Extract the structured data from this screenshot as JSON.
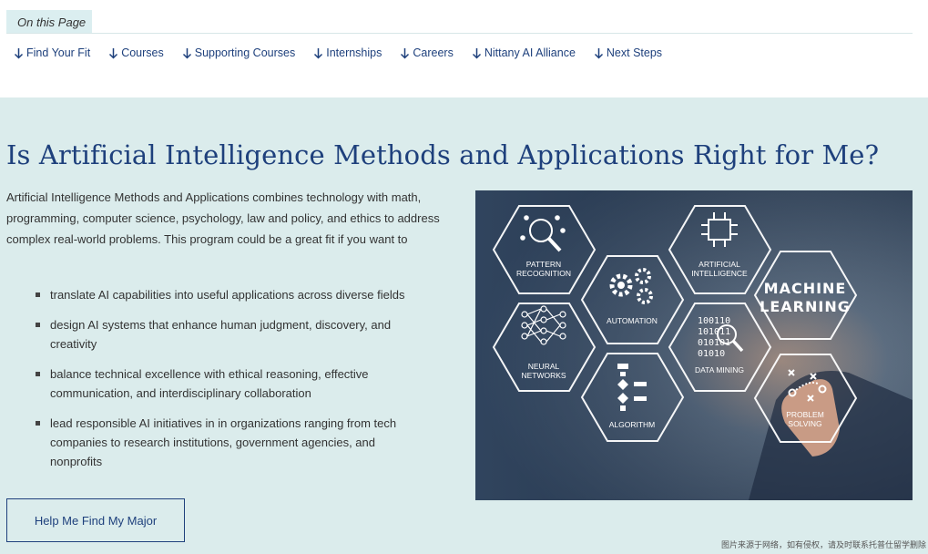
{
  "on_this_page": {
    "tab_label": "On this Page",
    "links": [
      {
        "label": "Find Your Fit"
      },
      {
        "label": "Courses"
      },
      {
        "label": "Supporting Courses"
      },
      {
        "label": "Internships"
      },
      {
        "label": "Careers"
      },
      {
        "label": "Nittany AI Alliance"
      },
      {
        "label": "Next Steps"
      }
    ]
  },
  "fit": {
    "title": "Is Artificial Intelligence Methods and Applications Right for Me?",
    "intro": "Artificial Intelligence Methods and Applications combines technology with math, programming, computer science, psychology, law and policy, and ethics to address complex real-world problems. This program could be a great fit if you want to",
    "items": [
      "translate AI capabilities into useful applications across diverse fields",
      "design AI systems that enhance human judgment, discovery, and creativity",
      "balance technical excellence with ethical reasoning, effective communication, and interdisciplinary collaboration",
      "lead responsible AI initiatives in in organizations ranging from tech companies to research institutions, government agencies, and nonprofits"
    ],
    "cta_label": "Help Me Find My Major"
  },
  "illustration": {
    "hexes": [
      {
        "label1": "PATTERN",
        "label2": "RECOGNITION",
        "icon": "magnifier-dots-icon"
      },
      {
        "label1": "ARTIFICIAL",
        "label2": "INTELLIGENCE",
        "icon": "ai-chip-icon"
      },
      {
        "label1": "AUTOMATION",
        "label2": "",
        "icon": "gears-icon"
      },
      {
        "label1": "MACHINE",
        "label2": "LEARNING",
        "icon": ""
      },
      {
        "label1": "NEURAL",
        "label2": "NETWORKS",
        "icon": "neural-net-icon"
      },
      {
        "label1": "DATA MINING",
        "label2": "",
        "icon": "binary-magnifier-icon"
      },
      {
        "label1": "ALGORITHM",
        "label2": "",
        "icon": "flowchart-icon"
      },
      {
        "label1": "PROBLEM",
        "label2": "SOLVING",
        "icon": "strategy-icon"
      }
    ],
    "binary": [
      "100110",
      "101011",
      "010101",
      "01010"
    ]
  },
  "credit": "图片来源于网络，如有侵权，请及时联系托普仕留学删除",
  "colors": {
    "brand": "#1e407c",
    "section_bg": "#dbecec",
    "tab_bg": "#dbeef0"
  }
}
